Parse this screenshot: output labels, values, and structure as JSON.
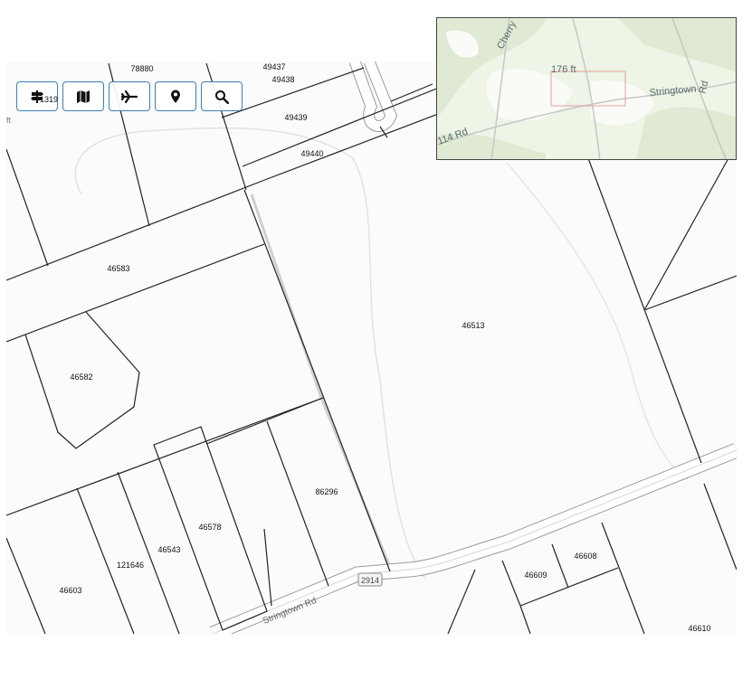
{
  "toolbar": {
    "buttons": [
      {
        "id": "layers",
        "icon": "signpost-icon"
      },
      {
        "id": "basemap",
        "icon": "map-icon"
      },
      {
        "id": "aerial",
        "icon": "airplane-icon"
      },
      {
        "id": "locate",
        "icon": "map-pin-icon"
      },
      {
        "id": "search",
        "icon": "search-icon"
      }
    ],
    "overlap_number": "1319"
  },
  "scale_fragment": "ft",
  "overview": {
    "scale_text": "176 ft",
    "labels": {
      "cherry": "Cherry",
      "stringtown": "Stringtown",
      "rd_vertical": "Rd",
      "rd_114": "114 Rd"
    }
  },
  "parcels": {
    "p78880": "78880",
    "p49437": "49437",
    "p49438": "49438",
    "p49439": "49439",
    "p49440": "49440",
    "p46583": "46583",
    "p46582": "46582",
    "p46513": "46513",
    "p86296": "86296",
    "p46578": "46578",
    "p46543": "46543",
    "p121646": "121646",
    "p46603": "46603",
    "p46609": "46609",
    "p46608": "46608",
    "p46610": "46610"
  },
  "roads": {
    "stringtown_rd": "Stringtown Rd",
    "route_2914": "2914"
  },
  "colors": {
    "button_border": "#3d7fb5",
    "parcel_line": "#222222",
    "road_casing": "#9a9a9a",
    "overview_bg": "#eef4e6"
  }
}
